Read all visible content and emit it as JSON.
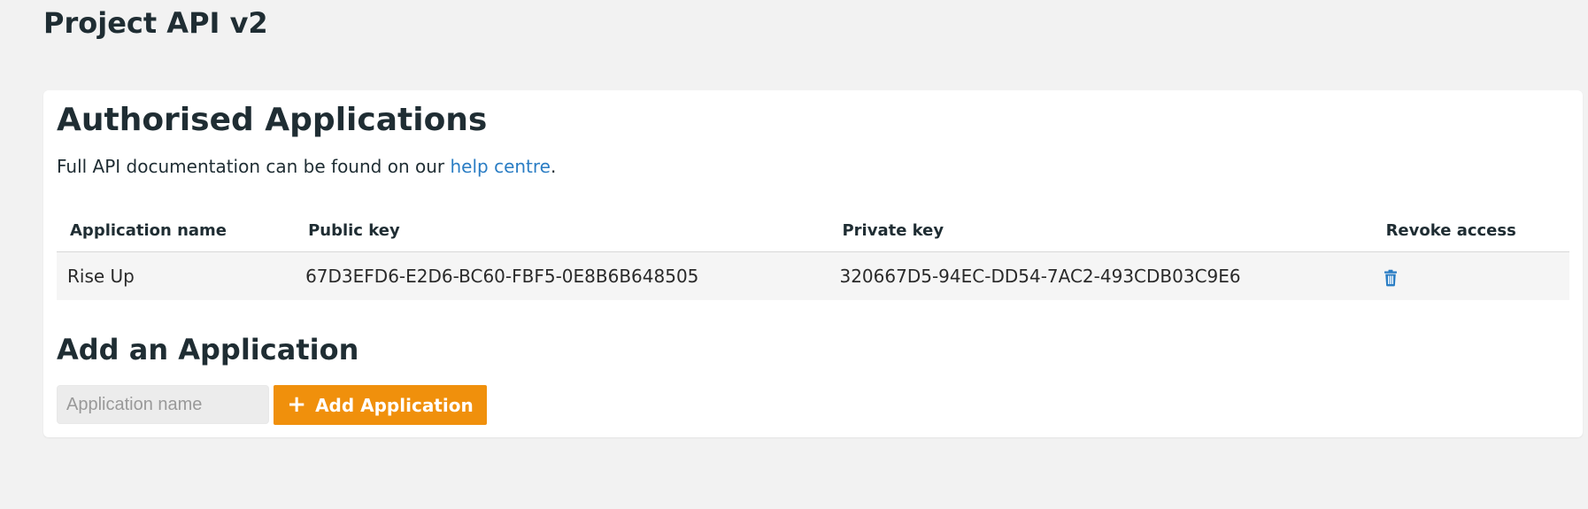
{
  "page": {
    "title": "Project API v2"
  },
  "apps_section": {
    "heading": "Authorised Applications",
    "intro_text": "Full API documentation can be found on our ",
    "help_link": "help centre",
    "intro_suffix": "."
  },
  "table": {
    "headers": {
      "name": "Application name",
      "public_key": "Public key",
      "private_key": "Private key",
      "revoke": "Revoke access"
    },
    "rows": [
      {
        "name": "Rise Up",
        "public_key": "67D3EFD6-E2D6-BC60-FBF5-0E8B6B648505",
        "private_key": "320667D5-94EC-DD54-7AC2-493CDB03C9E6",
        "revoke_icon": "trash-icon"
      }
    ]
  },
  "add_section": {
    "heading": "Add an Application",
    "input_placeholder": "Application name",
    "input_value": "",
    "button_label": "Add Application",
    "button_icon": "plus-icon"
  },
  "colors": {
    "accent": "#f0900c",
    "link": "#2a7dc4",
    "trash": "#2a7dc4"
  }
}
